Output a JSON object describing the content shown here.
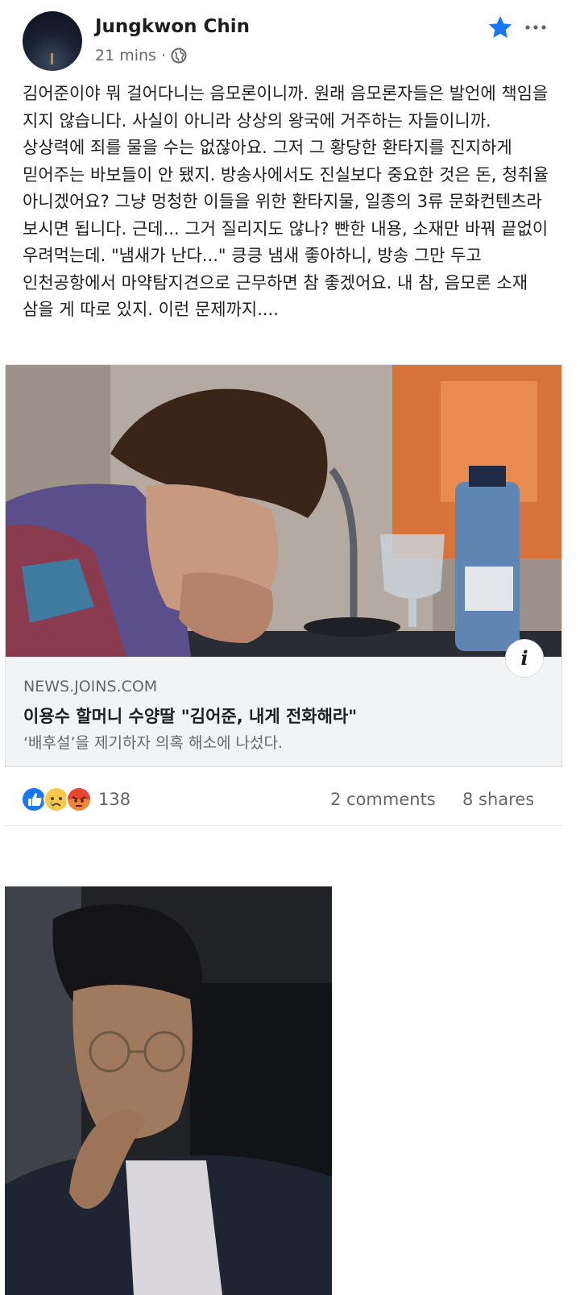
{
  "post": {
    "author": "Jungkwon Chin",
    "time": "21 mins",
    "separator": "·",
    "text": "김어준이야 뭐 걸어다니는 음모론이니까. 원래 음모론자들은 발언에 책임을 지지 않습니다. 사실이 아니라 상상의 왕국에 거주하는 자들이니까. 상상력에 죄를 물을 수는 없잖아요. 그저 그 황당한 환타지를 진지하게 믿어주는 바보들이 안 됐지. 방송사에서도 진실보다 중요한 것은 돈, 청취율 아니겠어요? 그냥 멍청한 이들을 위한 환타지물, 일종의 3류 문화컨텐츠라 보시면 됩니다. 근데... 그거 질리지도 않나? 빤한 내용, 소재만 바꿔 끝없이 우려먹는데. \"냄새가 난다...\" 킁킁 냄새 좋아하니, 방송 그만 두고 인천공항에서 마약탐지견으로 근무하면 참 좋겠어요. 내 참, 음모론 소재 삼을 게 따로 있지. 이런 문제까지....",
    "icons": {
      "privacy": "globe-icon",
      "favorite": "star-icon",
      "more": "more-icon"
    },
    "accent_color": "#1877f2"
  },
  "link": {
    "domain": "NEWS.JOINS.COM",
    "title": "이용수 할머니 수양딸 \"김어준, 내게 전화해라\"",
    "description": "‘배후설’을 제기하자 의혹 해소에 나섰다.",
    "info_label": "i"
  },
  "engagement": {
    "reaction_icons": [
      "like-icon",
      "sad-icon",
      "angry-icon"
    ],
    "reaction_count": "138",
    "comments": "2 comments",
    "shares": "8 shares"
  }
}
